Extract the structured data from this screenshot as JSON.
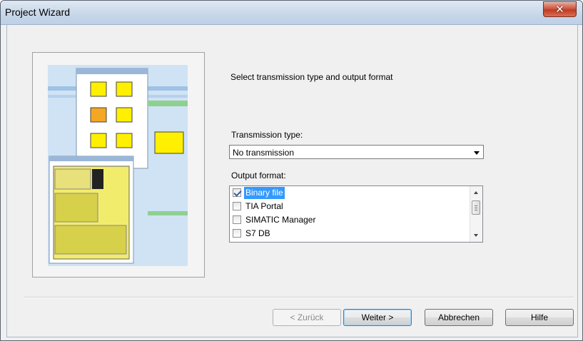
{
  "window": {
    "title": "Project Wizard"
  },
  "wizard": {
    "heading": "Select transmission type and output format",
    "transmission_label": "Transmission type:",
    "transmission_value": "No transmission",
    "output_label": "Output format:",
    "output_items": [
      {
        "label": "Binary file",
        "checked": true,
        "selected": true
      },
      {
        "label": "TIA Portal",
        "checked": false,
        "selected": false
      },
      {
        "label": "SIMATIC Manager",
        "checked": false,
        "selected": false
      },
      {
        "label": "S7 DB",
        "checked": false,
        "selected": false
      }
    ]
  },
  "buttons": {
    "back": "< Zurück",
    "next": "Weiter >",
    "cancel": "Abbrechen",
    "help": "Hilfe"
  },
  "colors": {
    "selection": "#3399ff",
    "close": "#c13b22"
  }
}
